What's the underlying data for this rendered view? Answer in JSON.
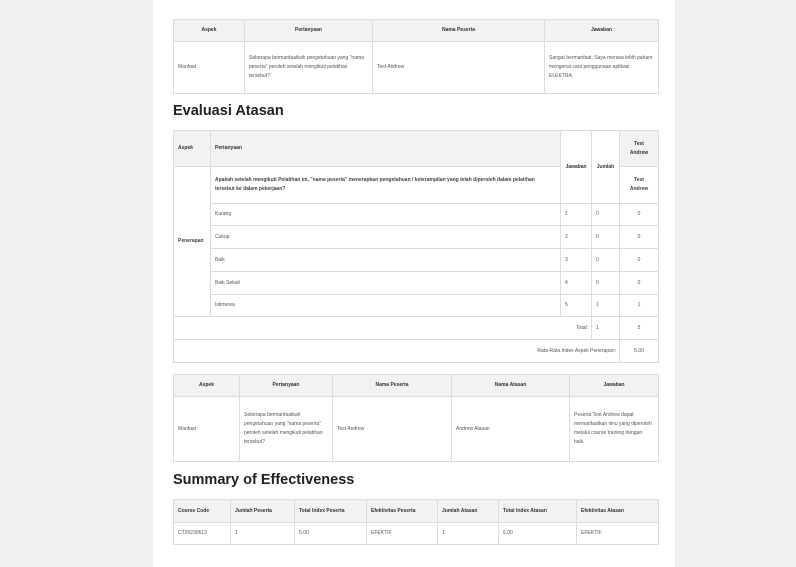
{
  "table1": {
    "headers": [
      "Aspek",
      "Pertanyaan",
      "Nama Peserta",
      "Jawaban"
    ],
    "row": {
      "aspek": "Manfaat",
      "pertanyaan": "Seberapa bermanfaatkah pengetahuan yang \"nama peserta\" peroleh setelah mengikuti pelatihan tersebut?",
      "nama": "Test Andrew",
      "jawaban": "Sangat bermanfaat. Saya merasa lebih paham mengenai cara penggunaan aplikasi ELEKTRA."
    }
  },
  "section1_title": "Evaluasi Atasan",
  "table2": {
    "h_aspek": "Aspek",
    "h_pertanyaan": "Pertanyaan",
    "h_jawaban": "Jawaban",
    "h_jumlah": "Jumlah",
    "h_person": "Test Andrew",
    "question": "Apakah setelah mengikuti Pelatihan ini, \"nama peserta\" menerapkan pengetahuan / keterampilan yang telah diperoleh dalam pelatihan tersebut ke dalam pekerjaan?",
    "person2": "Test Andrew",
    "aspek": "Penerapan",
    "options": [
      {
        "label": "Kurang",
        "jawaban": "1",
        "jumlah": "0",
        "score": "0"
      },
      {
        "label": "Cukup",
        "jawaban": "2",
        "jumlah": "0",
        "score": "0"
      },
      {
        "label": "Baik",
        "jawaban": "3",
        "jumlah": "0",
        "score": "0"
      },
      {
        "label": "Baik Sekali",
        "jawaban": "4",
        "jumlah": "0",
        "score": "0"
      },
      {
        "label": "Istimewa",
        "jawaban": "5",
        "jumlah": "1",
        "score": "1"
      }
    ],
    "total_label": "Total:",
    "total_jumlah": "1",
    "total_score": "5",
    "avg_label": "Rata-Rata Index Aspek Penerapan:",
    "avg_value": "5.00"
  },
  "table3": {
    "headers": [
      "Aspek",
      "Pertanyaan",
      "Nama Peserta",
      "Nama Atasan",
      "Jawaban"
    ],
    "row": {
      "aspek": "Manfaat",
      "pertanyaan": "Seberapa bermanfaatkah pengetahuan yang \"nama peserta\" peroleh setelah mengikuti pelatihan tersebut?",
      "nama": "Test Andrew",
      "atasan": "Andrew Atasan",
      "jawaban": "Peserta Test Andrew dapat memanfaatkan ilmu yang diperoleh melalui course training dengan baik."
    }
  },
  "section2_title": "Summary of Effectiveness",
  "table4": {
    "headers": [
      "Course Code",
      "Jumlah Peserta",
      "Total Index Peserta",
      "Efektivitas Peserta",
      "Jumlah Atasan",
      "Total Index Atasan",
      "Efektivitas Atasan"
    ],
    "row": [
      "CT20230613",
      "1",
      "5.00",
      "EFEKTIF",
      "1",
      "5.00",
      "EFEKTIF"
    ]
  }
}
